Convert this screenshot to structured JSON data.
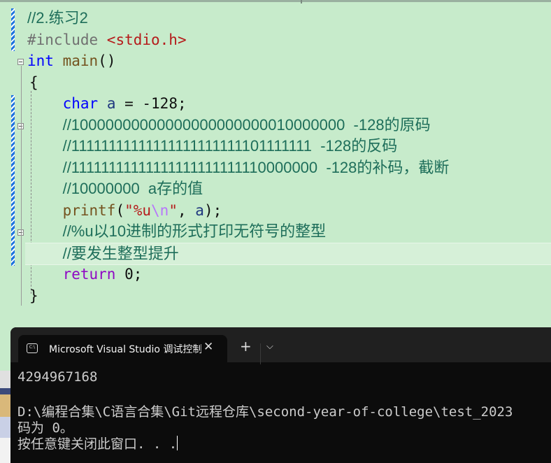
{
  "editor": {
    "lines": [
      [
        {
          "t": "//2.练习2",
          "c": "comment"
        }
      ],
      [
        {
          "t": "#include ",
          "c": "pre"
        },
        {
          "t": "<stdio.h>",
          "c": "include"
        }
      ],
      [
        {
          "t": "int",
          "c": "kw"
        },
        {
          "t": " ",
          "c": "plain"
        },
        {
          "t": "main",
          "c": "fn"
        },
        {
          "t": "()",
          "c": "plain"
        }
      ],
      [
        {
          "t": "{",
          "c": "plain"
        }
      ],
      [
        {
          "t": "    ",
          "c": "plain"
        },
        {
          "t": "char",
          "c": "kw"
        },
        {
          "t": " ",
          "c": "plain"
        },
        {
          "t": "a",
          "c": "var"
        },
        {
          "t": " = -128;",
          "c": "plain"
        }
      ],
      [
        {
          "t": "    ",
          "c": "plain"
        },
        {
          "t": "//10000000000000000000000010000000  -128的原码",
          "c": "comment"
        }
      ],
      [
        {
          "t": "    ",
          "c": "plain"
        },
        {
          "t": "//11111111111111111111111101111111  -128的反码",
          "c": "comment"
        }
      ],
      [
        {
          "t": "    ",
          "c": "plain"
        },
        {
          "t": "//11111111111111111111111110000000  -128的补码，截断",
          "c": "comment"
        }
      ],
      [
        {
          "t": "    ",
          "c": "plain"
        },
        {
          "t": "//10000000  a存的值",
          "c": "comment"
        }
      ],
      [
        {
          "t": "    ",
          "c": "plain"
        },
        {
          "t": "printf",
          "c": "fn"
        },
        {
          "t": "(",
          "c": "plain"
        },
        {
          "t": "\"%u",
          "c": "str"
        },
        {
          "t": "\\n",
          "c": "esc"
        },
        {
          "t": "\"",
          "c": "str"
        },
        {
          "t": ", ",
          "c": "plain"
        },
        {
          "t": "a",
          "c": "var"
        },
        {
          "t": ");",
          "c": "plain"
        }
      ],
      [
        {
          "t": "    ",
          "c": "plain"
        },
        {
          "t": "//%u以10进制的形式打印无符号的整型",
          "c": "comment"
        }
      ],
      [
        {
          "t": "    ",
          "c": "plain"
        },
        {
          "t": "//要发生整型提升",
          "c": "comment"
        }
      ],
      [
        {
          "t": "    ",
          "c": "plain"
        },
        {
          "t": "return",
          "c": "ret"
        },
        {
          "t": " 0;",
          "c": "plain"
        }
      ],
      [
        {
          "t": "}",
          "c": "plain"
        }
      ]
    ],
    "current_line": 11,
    "colors": {
      "background": "#c7ebcb",
      "keyword": "#0000ff",
      "comment": "#1e6e5a",
      "string": "#b51b1b",
      "function": "#74531f",
      "return": "#8f08c4"
    }
  },
  "terminal": {
    "tab_title": "Microsoft Visual Studio 调试控制台",
    "tab_icon": "console-icon",
    "close_icon": "close-icon",
    "new_tab_icon": "plus-icon",
    "dropdown_icon": "chevron-down-icon",
    "output": [
      "4294967168",
      "",
      "D:\\编程合集\\C语言合集\\Git远程仓库\\second-year-of-college\\test_2023",
      "码为 0。",
      "按任意键关闭此窗口. . ."
    ],
    "colors": {
      "background": "#0c0c0c",
      "text": "#cccccc",
      "tabbar": "#202020"
    }
  }
}
